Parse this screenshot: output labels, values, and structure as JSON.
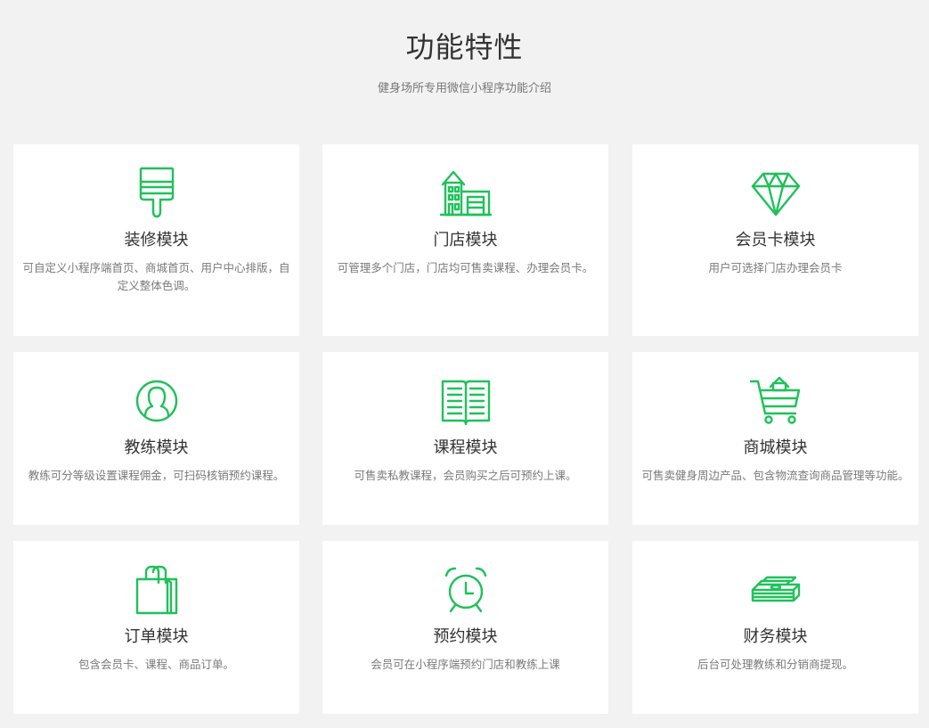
{
  "header": {
    "title": "功能特性",
    "subtitle": "健身场所专用微信小程序功能介绍"
  },
  "accent_color": "#1fc15a",
  "features": [
    {
      "icon": "paint-brush-icon",
      "title": "装修模块",
      "desc": "可自定义小程序端首页、商城首页、用户中心排版，自定义整体色调。"
    },
    {
      "icon": "storefront-icon",
      "title": "门店模块",
      "desc": "可管理多个门店，门店均可售卖课程、办理会员卡。"
    },
    {
      "icon": "diamond-icon",
      "title": "会员卡模块",
      "desc": "用户可选择门店办理会员卡"
    },
    {
      "icon": "user-circle-icon",
      "title": "教练模块",
      "desc": "教练可分等级设置课程佣金，可扫码核销预约课程。"
    },
    {
      "icon": "open-book-icon",
      "title": "课程模块",
      "desc": "可售卖私教课程，会员购买之后可预约上课。"
    },
    {
      "icon": "shopping-cart-icon",
      "title": "商城模块",
      "desc": "可售卖健身周边产品、包含物流查询商品管理等功能。"
    },
    {
      "icon": "shopping-bag-icon",
      "title": "订单模块",
      "desc": "包含会员卡、课程、商品订单。"
    },
    {
      "icon": "alarm-clock-icon",
      "title": "预约模块",
      "desc": "会员可在小程序端预约门店和教练上课"
    },
    {
      "icon": "money-stack-icon",
      "title": "财务模块",
      "desc": "后台可处理教练和分销商提现。"
    }
  ]
}
